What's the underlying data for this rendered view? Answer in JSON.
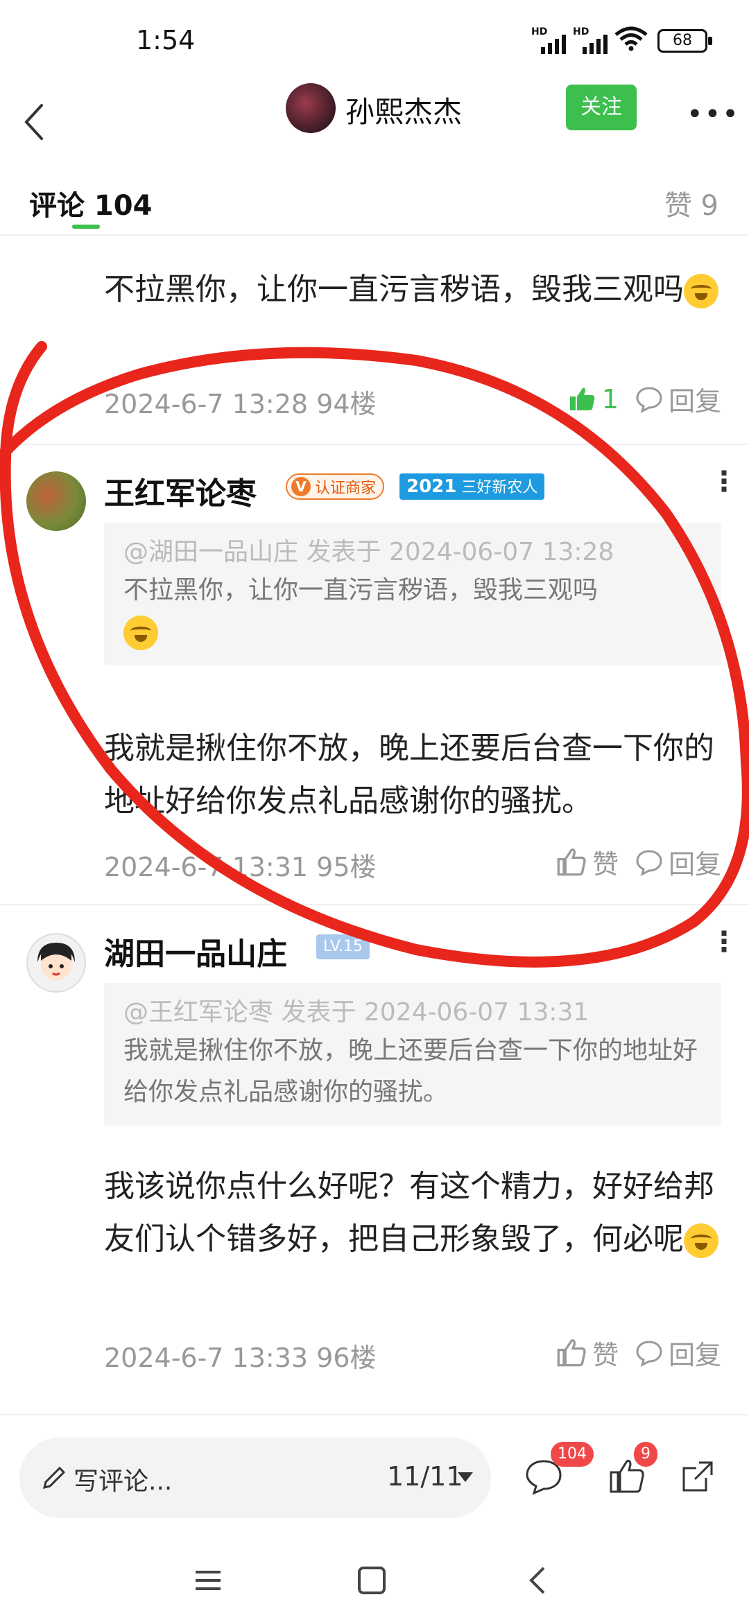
{
  "status_bar": {
    "time": "1:54",
    "signal1": "HD",
    "signal2": "HD",
    "battery": "68"
  },
  "header": {
    "username": "孙熙杰杰",
    "follow_label": "关注"
  },
  "tabs": {
    "comments_label": "评论 104",
    "likes_label": "赞 9"
  },
  "comments": [
    {
      "text": "不拉黑你，让你一直污言秽语，毁我三观吗",
      "meta": "2024-6-7 13:28  94楼",
      "like_count": "1",
      "reply_label": "回复"
    },
    {
      "username": "王红军论枣",
      "badge_merchant": "认证商家",
      "badge_merchant_icon": "V",
      "badge_farmer_year": "2021",
      "badge_farmer": "三好新农人",
      "quote_head": "@湖田一品山庄 发表于 2024-06-07 13:28",
      "quote_text": "不拉黑你，让你一直污言秽语，毁我三观吗",
      "text": "我就是揪住你不放，晚上还要后台查一下你的地址好给你发点礼品感谢你的骚扰。",
      "meta": "2024-6-7 13:31  95楼",
      "like_label": "赞",
      "reply_label": "回复"
    },
    {
      "username": "湖田一品山庄",
      "level": "LV.15",
      "quote_head": "@王红军论枣 发表于 2024-06-07 13:31",
      "quote_text": "我就是揪住你不放，晚上还要后台查一下你的地址好给你发点礼品感谢你的骚扰。",
      "text": "我该说你点什么好呢？有这个精力，好好给邦友们认个错多好，把自己形象毁了，何必呢",
      "meta": "2024-6-7 13:33  96楼",
      "like_label": "赞",
      "reply_label": "回复"
    }
  ],
  "bottom_bar": {
    "placeholder": "写评论...",
    "pager": "11/11",
    "comment_count": "104",
    "like_count": "9"
  },
  "colors": {
    "accent": "#3dbf4e",
    "badge_red": "#f04848",
    "annotation": "#e8261b"
  }
}
